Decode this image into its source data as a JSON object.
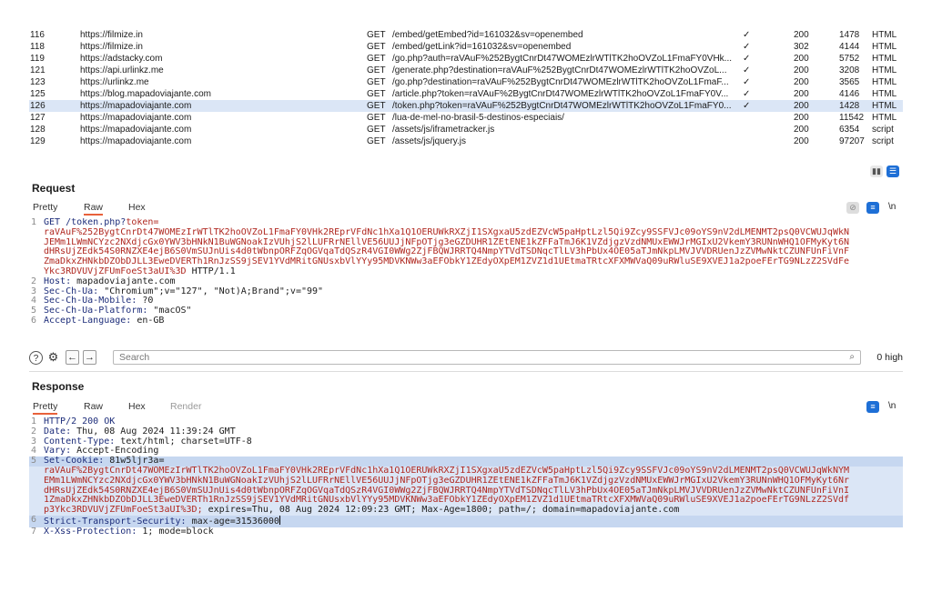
{
  "history": [
    {
      "num": "116",
      "host": "https://filmize.in",
      "method": "GET",
      "url": "/embed/getEmbed?id=161032&sv=openembed",
      "check": "✓",
      "status": "200",
      "length": "1478",
      "type": "HTML",
      "selected": false
    },
    {
      "num": "118",
      "host": "https://filmize.in",
      "method": "GET",
      "url": "/embed/getLink?id=161032&sv=openembed",
      "check": "✓",
      "status": "302",
      "length": "4144",
      "type": "HTML",
      "selected": false
    },
    {
      "num": "119",
      "host": "https://adstacky.com",
      "method": "GET",
      "url": "/go.php?auth=raVAuF%252BygtCnrDt47WOMEzlrWTlTK2hoOVZoL1FmaFY0VHk...",
      "check": "✓",
      "status": "200",
      "length": "5752",
      "type": "HTML",
      "selected": false
    },
    {
      "num": "121",
      "host": "https://api.urlinkz.me",
      "method": "GET",
      "url": "/generate.php?destination=raVAuF%252BygtCnrDt47WOMEzlrWTlTK2hoOVZoL...",
      "check": "✓",
      "status": "200",
      "length": "3208",
      "type": "HTML",
      "selected": false
    },
    {
      "num": "123",
      "host": "https://urlinkz.me",
      "method": "GET",
      "url": "/go.php?destination=raVAuF%252BygtCnrDt47WOMEzlrWTlTK2hoOVZoL1FmaF...",
      "check": "✓",
      "status": "200",
      "length": "3565",
      "type": "HTML",
      "selected": false
    },
    {
      "num": "125",
      "host": "https://blog.mapadoviajante.com",
      "method": "GET",
      "url": "/article.php?token=raVAuF%2BygtCnrDt47WOMEzlrWTlTK2hoOVZoL1FmaFY0V...",
      "check": "✓",
      "status": "200",
      "length": "4146",
      "type": "HTML",
      "selected": false
    },
    {
      "num": "126",
      "host": "https://mapadoviajante.com",
      "method": "GET",
      "url": "/token.php?token=raVAuF%252BygtCnrDt47WOMEzlrWTlTK2hoOVZoL1FmaFY0...",
      "check": "✓",
      "status": "200",
      "length": "1428",
      "type": "HTML",
      "selected": true
    },
    {
      "num": "127",
      "host": "https://mapadoviajante.com",
      "method": "GET",
      "url": "/lua-de-mel-no-brasil-5-destinos-especiais/",
      "check": "",
      "status": "200",
      "length": "11542",
      "type": "HTML",
      "selected": false
    },
    {
      "num": "128",
      "host": "https://mapadoviajante.com",
      "method": "GET",
      "url": "/assets/js/iframetracker.js",
      "check": "",
      "status": "200",
      "length": "6354",
      "type": "script",
      "selected": false
    },
    {
      "num": "129",
      "host": "https://mapadoviajante.com",
      "method": "GET",
      "url": "/assets/js/jquery.js",
      "check": "",
      "status": "200",
      "length": "97207",
      "type": "script",
      "selected": false
    }
  ],
  "request": {
    "title": "Request",
    "tabs": [
      "Pretty",
      "Raw",
      "Hex"
    ],
    "active_tab": "Raw",
    "lines": [
      {
        "no": "1",
        "k": "GET /token.php?",
        "r": "token=",
        "rest": ""
      },
      {
        "no": "",
        "k": "",
        "r": "raVAuF%252BygtCnrDt47WOMEzIrWTlTK2hoOVZoL1FmaFY0VHk2REprVFdNc1hXa1Q1OERUWkRXZjI1SXgxaU5zdEZVcW5paHptLzl5Qi9Zcy9SSFVJc09oYS9nV2dLMENMT2psQ0VCWUJqWkN",
        "rest": ""
      },
      {
        "no": "",
        "k": "",
        "r": "JEMm1LWmNCYzc2NXdjcGx0YWV3bHNkN1BuWGNoakIzVUhjS2lLUFRrNEllVE56UUJjNFpOTjg3eGZDUHR1ZEtENE1kZFFaTmJ6K1VZdjgzVzdNMUxEWWJrMGIxU2VkemY3RUNnWHQ1OFMyKyt6N",
        "rest": ""
      },
      {
        "no": "",
        "k": "",
        "r": "dHRsUjZEdk54S0RNZXE4ejB6S0VmSUJnUis4d0tWbnpORFZqOGVqaTdQSzR4VGI0WWg2ZjFBQWJRRTQ4NmpYTVdTSDNqcTlLV3hPbUx4OE05aTJmNkpLMVJVVDRUenJzZVMwNktCZUNFUnFiVnF",
        "rest": ""
      },
      {
        "no": "",
        "k": "",
        "r": "ZmaDkxZHNkbDZObDJLL3EweDVERTh1RnJzSS9jSEV1YVdMRitGNUsxbVlYYy95MDVKNWw3aEFObkY1ZEdyOXpEM1ZVZ1d1UEtmaTRtcXFXMWVaQ09uRWluSE9XVEJ1a2poeFErTG9NLzZ2SVdFe",
        "rest": ""
      },
      {
        "no": "",
        "k": "",
        "r": "Ykc3RDVUVjZFUmFoeSt3aUI%3D",
        "rest": " HTTP/1.1"
      },
      {
        "no": "2",
        "k": "Host:",
        "r": "",
        "rest": " mapadoviajante.com"
      },
      {
        "no": "3",
        "k": "Sec-Ch-Ua:",
        "r": "",
        "rest": " \"Chromium\";v=\"127\", \"Not)A;Brand\";v=\"99\""
      },
      {
        "no": "4",
        "k": "Sec-Ch-Ua-Mobile:",
        "r": "",
        "rest": " ?0"
      },
      {
        "no": "5",
        "k": "Sec-Ch-Ua-Platform:",
        "r": "",
        "rest": " \"macOS\""
      },
      {
        "no": "6",
        "k": "Accept-Language:",
        "r": "",
        "rest": " en-GB"
      }
    ]
  },
  "search": {
    "placeholder": "Search",
    "highlights": "0 high"
  },
  "response": {
    "title": "Response",
    "tabs": [
      "Pretty",
      "Raw",
      "Hex",
      "Render"
    ],
    "active_tab": "Pretty",
    "lines": [
      {
        "no": "1",
        "k": "HTTP/2 200 OK",
        "r": "",
        "rest": "",
        "hl": ""
      },
      {
        "no": "2",
        "k": "Date:",
        "r": "",
        "rest": " Thu, 08 Aug 2024 11:39:24 GMT",
        "hl": ""
      },
      {
        "no": "3",
        "k": "Content-Type:",
        "r": "",
        "rest": " text/html; charset=UTF-8",
        "hl": ""
      },
      {
        "no": "4",
        "k": "Vary:",
        "r": "",
        "rest": " Accept-Encoding",
        "hl": ""
      },
      {
        "no": "5",
        "k": "Set-Cookie:",
        "r": "",
        "rest": " 81w5ljr3a=",
        "hl": "hl2"
      },
      {
        "no": "",
        "k": "",
        "r": "raVAuF%2BygtCnrDt47WOMEzIrWTlTK2hoOVZoL1FmaFY0VHk2REprVFdNc1hXa1Q1OERUWkRXZjI1SXgxaU5zdEZVcW5paHptLzl5Qi9Zcy9SSFVJc09oYS9nV2dLMENMT2psQ0VCWUJqWkNYM",
        "rest": "",
        "hl": "hl"
      },
      {
        "no": "",
        "k": "",
        "r": "EMm1LWmNCYzc2NXdjcGx0YWV3bHNkN1BuWGNoakIzVUhjS2lLUFRrNEllVE56UUJjNFpOTjg3eGZDUHR1ZEtENE1kZFFaTmJ6K1VZdjgzVzdNMUxEWWJrMGIxU2VkemY3RUNnWHQ1OFMyKyt6Nr",
        "rest": "",
        "hl": "hl"
      },
      {
        "no": "",
        "k": "",
        "r": "dHRsUjZEdk54S0RNZXE4ejB6S0VmSUJnUis4d0tWbnpORFZqOGVqaTdQSzR4VGI0WWg2ZjFBQWJRRTQ4NmpYTVdTSDNqcTlLV3hPbUx4OE05aTJmNkpLMVJVVDRUenJzZVMwNktCZUNFUnFiVnI",
        "rest": "",
        "hl": "hl"
      },
      {
        "no": "",
        "k": "",
        "r": "1ZmaDkxZHNkbDZObDJLL3EweDVERTh1RnJzSS9jSEV1YVdMRitGNUsxbVlYYy95MDVKNWw3aEFObkY1ZEdyOXpEM1ZVZ1d1UEtmaTRtcXFXMWVaQ09uRWluSE9XVEJ1a2poeFErTG9NLzZ2SVdf",
        "rest": "",
        "hl": "hl"
      },
      {
        "no": "",
        "k": "",
        "r": "p3Ykc3RDVUVjZFUmFoeSt3aUI%3D;",
        "rest": " expires=Thu, 08 Aug 2024 12:09:23 GMT; Max-Age=1800; path=/; domain=mapadoviajante.com",
        "hl": "hl"
      },
      {
        "no": "6",
        "k": "Strict-Transport-Security:",
        "r": "",
        "rest": " max-age=31536000",
        "hl": "hl2",
        "cursor": true
      },
      {
        "no": "7",
        "k": "X-Xss-Protection:",
        "r": "",
        "rest": " 1; mode=block",
        "hl": ""
      }
    ]
  },
  "icons": {
    "help": "?",
    "settings": "⚙",
    "back": "←",
    "forward": "→",
    "search": "⌕",
    "newline": "\\n"
  }
}
